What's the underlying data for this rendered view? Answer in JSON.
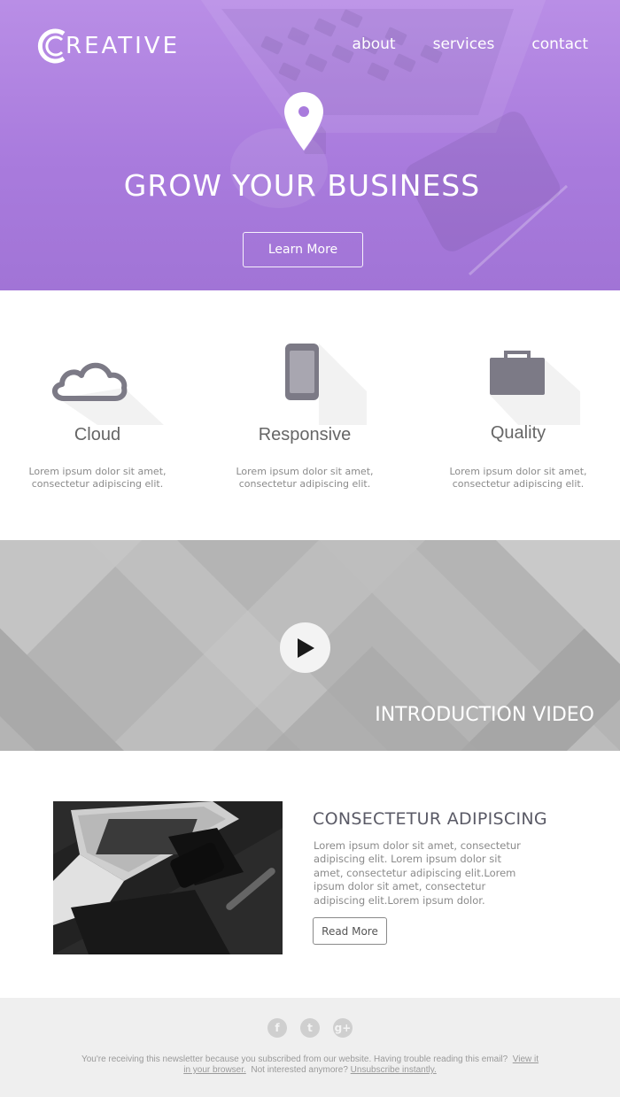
{
  "header": {
    "logo_text": "REATIVE",
    "nav": [
      "about",
      "services",
      "contact"
    ]
  },
  "hero": {
    "icon": "map-pin-icon",
    "title": "GROW YOUR BUSINESS",
    "button_label": "Learn More"
  },
  "features": [
    {
      "icon": "cloud-icon",
      "title": "Cloud",
      "text": "Lorem ipsum dolor sit amet, consectetur adipiscing elit."
    },
    {
      "icon": "phone-icon",
      "title": "Responsive",
      "text": "Lorem ipsum dolor sit amet, consectetur adipiscing elit."
    },
    {
      "icon": "briefcase-icon",
      "title": "Quality",
      "text": "Lorem ipsum dolor sit amet, consectetur adipiscing elit."
    }
  ],
  "video": {
    "icon": "play-icon",
    "title": "INTRODUCTION VIDEO"
  },
  "article": {
    "title": "CONSECTETUR ADIPISCING",
    "body": "Lorem ipsum dolor sit amet, consectetur adipiscing elit. Lorem ipsum dolor sit amet, consectetur adipiscing elit.Lorem ipsum dolor sit amet, consectetur adipiscing elit.Lorem ipsum dolor.",
    "button_label": "Read More"
  },
  "footer": {
    "social": [
      "f",
      "t",
      "g+"
    ],
    "text_before": "You're receiving this newsletter because you subscribed from our website. Having trouble reading this email?",
    "view_link": "View it in your browser.",
    "text_middle": "Not interested anymore?",
    "unsubscribe_link": "Unsubscribe instantly."
  },
  "colors": {
    "hero_purple": "#a97bdd",
    "icon_gray": "#7c7a86",
    "text_gray": "#8a8a8a",
    "footer_bg": "#efefef"
  }
}
